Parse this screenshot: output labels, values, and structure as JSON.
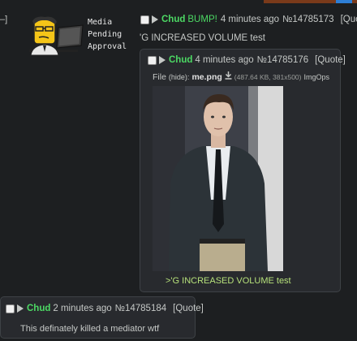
{
  "side_bracket": "–]",
  "media": {
    "lines": [
      "Media",
      "Pending",
      "Approval"
    ]
  },
  "op": {
    "name": "Chud",
    "subject": "BUMP!",
    "time": "4 minutes ago",
    "post_no": "№14785173",
    "quote": "[Quote]",
    "body": "'G INCREASED VOLUME test"
  },
  "reply1": {
    "name": "Chud",
    "time": "4 minutes ago",
    "post_no": "№14785176",
    "quote": "[Quote]",
    "file_label": "File",
    "hide_label": "(hide):",
    "filename": "me.png",
    "download_icon": "download-icon",
    "file_info": "(487.64 KB, 381x500)",
    "imgops": "ImgOps",
    "greentext": ">'G INCREASED VOLUME test"
  },
  "reply2": {
    "name": "Chud",
    "time": "2 minutes ago",
    "post_no": "№14785184",
    "quote": "[Quote]",
    "body": "This definately killed a mediator wtf"
  },
  "colors": {
    "background": "#1d1f21",
    "post_bg": "#282a2e",
    "name": "#4cd964",
    "greentext": "#b5e07a"
  }
}
